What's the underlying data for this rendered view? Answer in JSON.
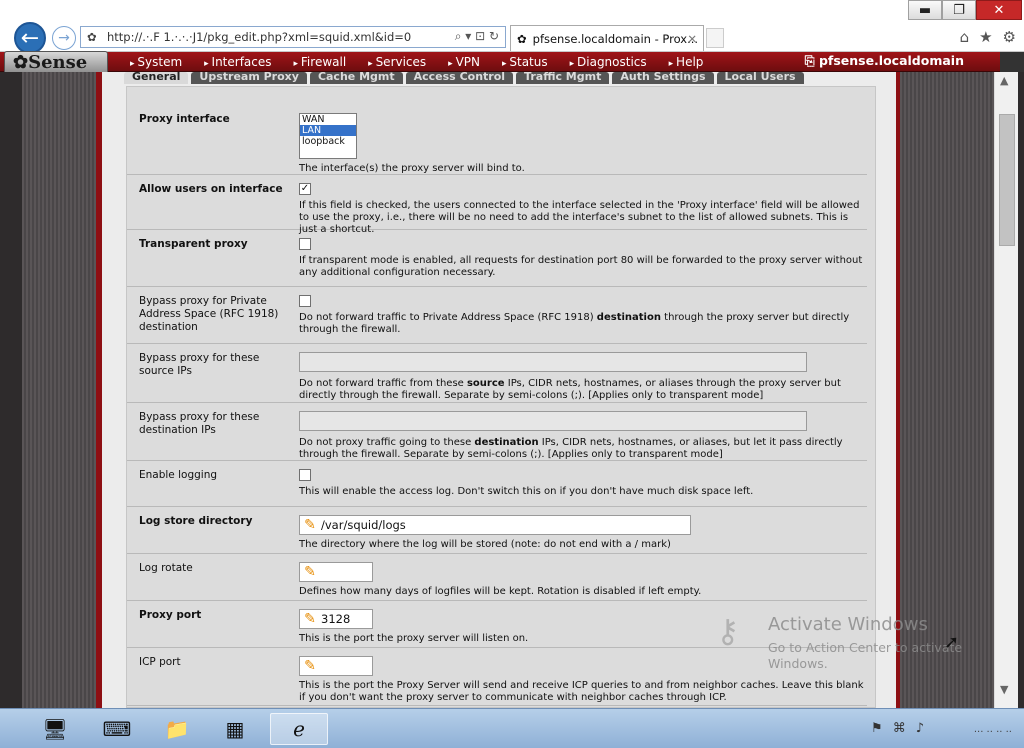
{
  "window_controls": {
    "minimize": "▬",
    "maximize": "❐",
    "close": "✕"
  },
  "browser": {
    "back_icon": "←",
    "forward_icon": "→",
    "url": "http://.·.F 1.·.·.·J1/pkg_edit.php?xml=squid.xml&id=0",
    "url_tools": "⌕ ▾ ⊡ ↻",
    "tab_title": "pfsense.localdomain - Prox...",
    "tab_close": "✕",
    "right_icons": [
      "home-icon",
      "star-icon",
      "gear-icon"
    ]
  },
  "menubar": {
    "logo": "Sense",
    "items": [
      "System",
      "Interfaces",
      "Firewall",
      "Services",
      "VPN",
      "Status",
      "Diagnostics",
      "Help"
    ],
    "hostname": "pfsense.localdomain"
  },
  "page_tabs": [
    "General",
    "Upstream Proxy",
    "Cache Mgmt",
    "Access Control",
    "Traffic Mgmt",
    "Auth Settings",
    "Local Users"
  ],
  "form": {
    "proxy_interface": {
      "label": "Proxy interface",
      "options": [
        "WAN",
        "LAN",
        "loopback"
      ],
      "selected": "LAN",
      "help": "The interface(s) the proxy server will bind to."
    },
    "allow_users": {
      "label": "Allow users on interface",
      "checked": true,
      "check_mark": "✓",
      "help": "If this field is checked, the users connected to the interface selected in the 'Proxy interface' field will be allowed to use the proxy, i.e., there will be no need to add the interface's subnet to the list of allowed subnets. This is just a shortcut."
    },
    "transparent": {
      "label": "Transparent proxy",
      "checked": false,
      "help": "If transparent mode is enabled, all requests for destination port 80 will be forwarded to the proxy server without any additional configuration necessary."
    },
    "bypass_private": {
      "label": "Bypass proxy for Private Address Space (RFC 1918) destination",
      "checked": false,
      "help_pre": "Do not forward traffic to Private Address Space (RFC 1918) ",
      "help_bold": "destination",
      "help_post": " through the proxy server but directly through the firewall."
    },
    "bypass_source": {
      "label": "Bypass proxy for these source IPs",
      "value": "",
      "help_pre": "Do not forward traffic from these ",
      "help_bold": "source",
      "help_post": " IPs, CIDR nets, hostnames, or aliases through the proxy server but directly through the firewall. Separate by semi-colons (;). [Applies only to transparent mode]"
    },
    "bypass_dest": {
      "label": "Bypass proxy for these destination IPs",
      "value": "",
      "help_pre": "Do not proxy traffic going to these ",
      "help_bold": "destination",
      "help_post": " IPs, CIDR nets, hostnames, or aliases, but let it pass directly through the firewall. Separate by semi-colons (;). [Applies only to transparent mode]"
    },
    "logging": {
      "label": "Enable logging",
      "checked": false,
      "help": "This will enable the access log. Don't switch this on if you don't have much disk space left."
    },
    "log_dir": {
      "label": "Log store directory",
      "value": "/var/squid/logs",
      "help": "The directory where the log will be stored (note: do not end with a / mark)"
    },
    "log_rotate": {
      "label": "Log rotate",
      "value": "",
      "help": "Defines how many days of logfiles will be kept. Rotation is disabled if left empty."
    },
    "proxy_port": {
      "label": "Proxy port",
      "value": "3128",
      "help": "This is the port the proxy server will listen on."
    },
    "icp_port": {
      "label": "ICP port",
      "value": "",
      "help": "This is the port the Proxy Server will send and receive ICP queries to and from neighbor caches. Leave this blank if you don't want the proxy server to communicate with neighbor caches through ICP."
    }
  },
  "watermark": {
    "title": "Activate Windows",
    "subtitle": "Go to Action Center to activate Windows."
  },
  "taskbar": {
    "clock": "··· ·· ·· ··"
  }
}
